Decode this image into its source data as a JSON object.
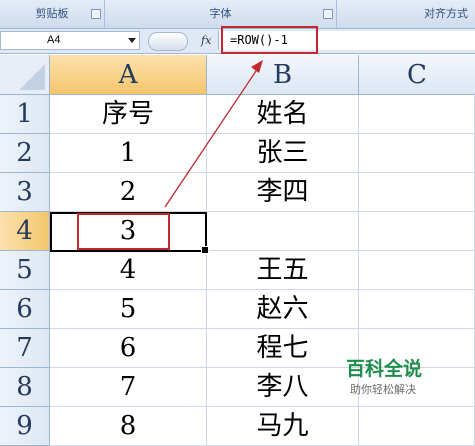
{
  "ribbon": {
    "groups": [
      "剪贴板",
      "字体",
      "对齐方式"
    ]
  },
  "formula_bar": {
    "name_box": "A4",
    "fx_label": "fx",
    "formula": "=ROW()-1"
  },
  "grid": {
    "columns": [
      "A",
      "B",
      "C"
    ],
    "rows": [
      "1",
      "2",
      "3",
      "4",
      "5",
      "6",
      "7",
      "8",
      "9"
    ],
    "selected_column": "A",
    "selected_row": "4",
    "cells": {
      "A": [
        "序号",
        "1",
        "2",
        "3",
        "4",
        "5",
        "6",
        "7",
        "8"
      ],
      "B": [
        "姓名",
        "张三",
        "李四",
        "",
        "王五",
        "赵六",
        "程七",
        "李八",
        "马九"
      ],
      "C": [
        "",
        "",
        "",
        "",
        "",
        "",
        "",
        "",
        ""
      ]
    }
  },
  "annotations": {
    "highlight_color": "#c0282e"
  },
  "watermark": {
    "title": "百科全说",
    "subtitle": "助你轻松解决"
  }
}
